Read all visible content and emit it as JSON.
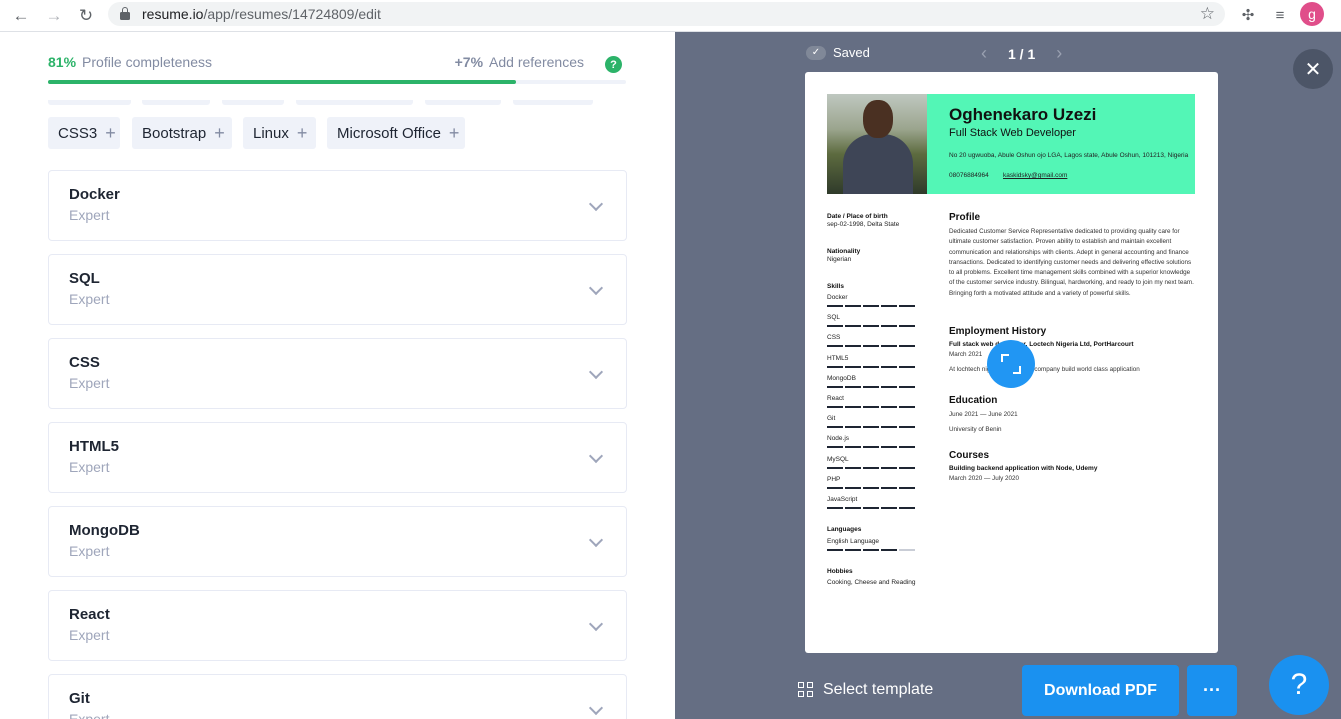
{
  "browser": {
    "url_host": "resume.io",
    "url_path": "/app/resumes/14724809/edit",
    "profile_initial": "g"
  },
  "editor": {
    "completeness_pct": "81%",
    "completeness_label": "Profile completeness",
    "completeness_value": 0.81,
    "bonus_pct": "+7%",
    "bonus_label": "Add references",
    "help_label": "?",
    "suggested_chips": [
      "CSS3",
      "Bootstrap",
      "Linux",
      "Microsoft Office"
    ],
    "skills": [
      {
        "name": "Docker",
        "level": "Expert"
      },
      {
        "name": "SQL",
        "level": "Expert"
      },
      {
        "name": "CSS",
        "level": "Expert"
      },
      {
        "name": "HTML5",
        "level": "Expert"
      },
      {
        "name": "MongoDB",
        "level": "Expert"
      },
      {
        "name": "React",
        "level": "Expert"
      },
      {
        "name": "Git",
        "level": "Expert"
      }
    ]
  },
  "preview": {
    "saved_label": "Saved",
    "page_indicator": "1 / 1",
    "select_template_label": "Select template",
    "download_label": "Download PDF",
    "more_label": "···",
    "help_label": "?",
    "close_label": "✕"
  },
  "resume": {
    "name": "Oghenekaro Uzezi",
    "title": "Full Stack Web Developer",
    "address": "No 20 ugwuoba, Abule Oshun ojo LGA, Lagos state, Abule Oshun, 101213, Nigeria",
    "phone": "08076884964",
    "email": "kaskidsky@gmail.com",
    "dob_heading": "Date / Place of birth",
    "dob": "sep-02-1998, Delta State",
    "nationality_heading": "Nationality",
    "nationality": "Nigerian",
    "skills_heading": "Skills",
    "skills": [
      {
        "name": "Docker",
        "level": 5
      },
      {
        "name": "SQL",
        "level": 5
      },
      {
        "name": "CSS",
        "level": 5
      },
      {
        "name": "HTML5",
        "level": 5
      },
      {
        "name": "MongoDB",
        "level": 5
      },
      {
        "name": "React",
        "level": 5
      },
      {
        "name": "Git",
        "level": 5
      },
      {
        "name": "Node.js",
        "level": 5
      },
      {
        "name": "MySQL",
        "level": 5
      },
      {
        "name": "PHP",
        "level": 5
      },
      {
        "name": "JavaScript",
        "level": 5
      }
    ],
    "languages_heading": "Languages",
    "language": {
      "name": "English Language",
      "level": 4
    },
    "hobbies_heading": "Hobbies",
    "hobbies": "Cooking, Cheese and Reading",
    "profile_heading": "Profile",
    "profile_text": "Dedicated Customer Service Representative dedicated to providing quality care for ultimate customer satisfaction. Proven ability to establish and maintain excellent communication and relationships with clients. Adept in general accounting and finance transactions. Dedicated to identifying customer needs and delivering effective solutions to all problems. Excellent time management skills combined with a superior knowledge of the customer service industry. Bilingual, hardworking, and ready to join my next team. Bringing forth a motivated attitude and a variety of powerful skills.",
    "employment_heading": "Employment History",
    "job_title": "Full stack web developer, Loctech Nigeria Ltd, PortHarcourt",
    "job_dates": "March 2021",
    "job_desc": "At lochtech nigeria ltd we help company build world class application",
    "education_heading": "Education",
    "edu_dates": "June 2021 — June 2021",
    "edu_school": "University of Benin",
    "courses_heading": "Courses",
    "course_title": "Building backend application with Node, Udemy",
    "course_dates": "March 2020 — July 2020"
  }
}
